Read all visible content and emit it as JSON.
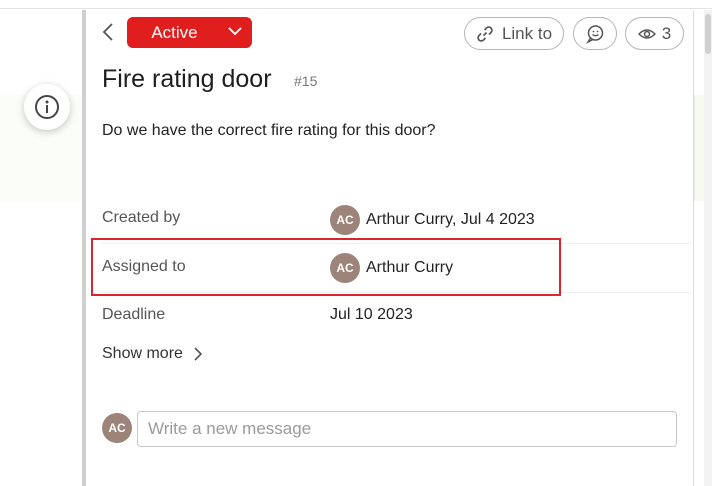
{
  "header": {
    "status_label": "Active",
    "link_label": "Link to",
    "watchers_count": "3"
  },
  "issue": {
    "title": "Fire rating door",
    "number": "#15",
    "description": "Do we have the correct fire rating for this door?"
  },
  "fields": {
    "created_by": {
      "label": "Created by",
      "initials": "AC",
      "value": "Arthur Curry, Jul 4 2023"
    },
    "assigned_to": {
      "label": "Assigned to",
      "initials": "AC",
      "value": "Arthur Curry"
    },
    "deadline": {
      "label": "Deadline",
      "value": "Jul 10 2023"
    }
  },
  "show_more_label": "Show more",
  "composer": {
    "initials": "AC",
    "placeholder": "Write a new message"
  },
  "colors": {
    "status_active": "#e01e1e",
    "avatar": "#9c847a",
    "highlight": "#d8262c"
  },
  "icons": [
    "info-icon",
    "back-chevron-icon",
    "chevron-down-icon",
    "link-icon",
    "comment-icon",
    "eye-icon",
    "chevron-right-icon"
  ]
}
